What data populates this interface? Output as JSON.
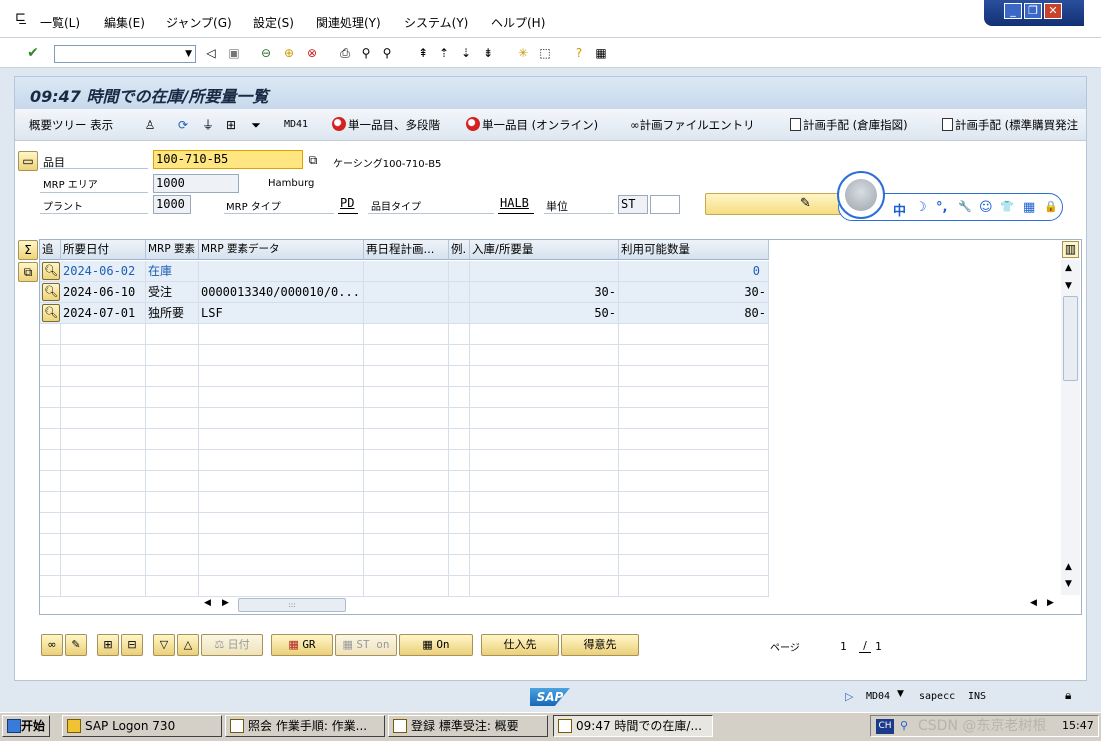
{
  "menu": {
    "items": [
      "一覧(L)",
      "編集(E)",
      "ジャンプ(G)",
      "設定(S)",
      "関連処理(Y)",
      "システム(Y)",
      "ヘルプ(H)"
    ]
  },
  "window_controls": {
    "minimize": "_",
    "restore": "❐",
    "close": "✕"
  },
  "screen_title": "09:47 時間での在庫/所要量一覧",
  "app_toolbar": {
    "tree": "概要ツリー 表示",
    "md41": "MD41",
    "single_multi": "単一品目、多段階",
    "single_online": "単一品目 (オンライン)",
    "plan_file": "計画ファイルエントリ",
    "plan_warehouse": "計画手配 (倉庫指図)",
    "plan_standard": "計画手配 (標準購買発注"
  },
  "header": {
    "material_label": "品目",
    "material_value": "100-710-B5",
    "material_desc": "ケーシング100-710-B5",
    "mrp_area_label": "MRP エリア",
    "mrp_area_value": "1000",
    "mrp_area_name": "Hamburg",
    "plant_label": "プラント",
    "plant_value": "1000",
    "mrp_type_label": "MRP タイプ",
    "mrp_type_value": "PD",
    "material_type_label": "品目タイプ",
    "material_type_value": "HALB",
    "unit_label": "単位",
    "unit_value": "ST"
  },
  "ime": {
    "glyphs": [
      "中",
      "☽",
      "°,",
      "🔧",
      "☺",
      "👕",
      "▦",
      "🔒"
    ]
  },
  "grid": {
    "columns": [
      "追",
      "所要日付",
      "MRP 要素",
      "MRP 要素データ",
      "再日程計画...",
      "例.",
      "入庫/所要量",
      "利用可能数量"
    ],
    "rows": [
      {
        "date": "2024-06-02",
        "element": "在庫",
        "data": "",
        "qty": "",
        "avail": "0",
        "highlight": true
      },
      {
        "date": "2024-06-10",
        "element": "受注",
        "data": "0000013340/000010/0...",
        "qty": "30-",
        "avail": "30-",
        "highlight": false
      },
      {
        "date": "2024-07-01",
        "element": "独所要",
        "data": "LSF",
        "qty": "50-",
        "avail": "80-",
        "highlight": false
      }
    ]
  },
  "bottom_buttons": {
    "date": "日付",
    "gr": "GR",
    "st_on": "ST on",
    "on": "On",
    "vendor": "仕入先",
    "customer": "得意先",
    "page_label": "ページ",
    "page_current": "1",
    "page_sep": "/",
    "page_total": "1"
  },
  "status": {
    "tcode": "MD04",
    "system": "sapecc",
    "mode": "INS",
    "logo": "SAP"
  },
  "taskbar": {
    "start": "开始",
    "tasks": [
      "SAP Logon 730",
      "照会 作業手順: 作業...",
      "登録 標準受注: 概要",
      "09:47 時間での在庫/..."
    ],
    "lang": "CH",
    "clock": "15:47",
    "watermark": "CSDN @东京老树根"
  }
}
